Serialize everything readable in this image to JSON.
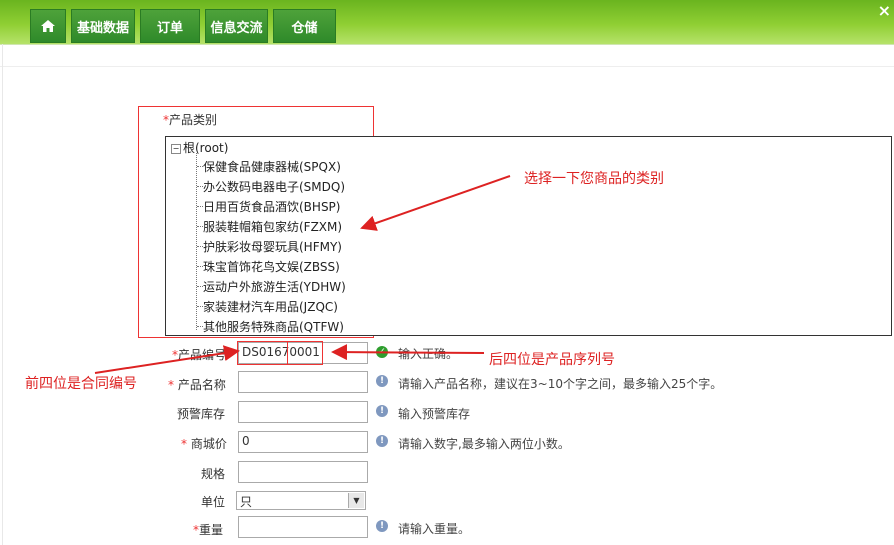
{
  "nav": {
    "items": [
      {
        "label": ""
      },
      {
        "label": "基础数据"
      },
      {
        "label": "订单"
      },
      {
        "label": "信息交流"
      },
      {
        "label": "仓储"
      }
    ],
    "close": "×"
  },
  "category": {
    "label": "产品类别",
    "required_mark": "*",
    "root": "根(root)",
    "items": [
      "保健食品健康器械(SPQX)",
      "办公数码电器电子(SMDQ)",
      "日用百货食品酒饮(BHSP)",
      "服装鞋帽箱包家纺(FZXM)",
      "护肤彩妆母婴玩具(HFMY)",
      "珠宝首饰花鸟文娱(ZBSS)",
      "运动户外旅游生活(YDHW)",
      "家装建材汽车用品(JZQC)",
      "其他服务特殊商品(QTFW)"
    ]
  },
  "form": {
    "code": {
      "label": "产品编号",
      "value": "DS01670001",
      "hint": "输入正确。"
    },
    "name": {
      "label": "产品名称",
      "value": "",
      "hint": "请输入产品名称，建议在3~10个字之间，最多输入25个字。"
    },
    "stock": {
      "label": "预警库存",
      "value": "",
      "hint": "输入预警库存"
    },
    "price": {
      "label": "商城价",
      "value": "0",
      "hint": "请输入数字,最多输入两位小数。"
    },
    "spec": {
      "label": "规格",
      "value": ""
    },
    "unit": {
      "label": "单位",
      "value": "只"
    },
    "weight": {
      "label": "重量",
      "value": "",
      "hint": "请输入重量。"
    }
  },
  "annotations": {
    "category": "选择一下您商品的类别",
    "serial": "后四位是产品序列号",
    "contract": "前四位是合同编号"
  },
  "colors": {
    "annotation": "#dd2222",
    "nav_green": "#2f8a2a",
    "topbar": "#8fcf33"
  }
}
